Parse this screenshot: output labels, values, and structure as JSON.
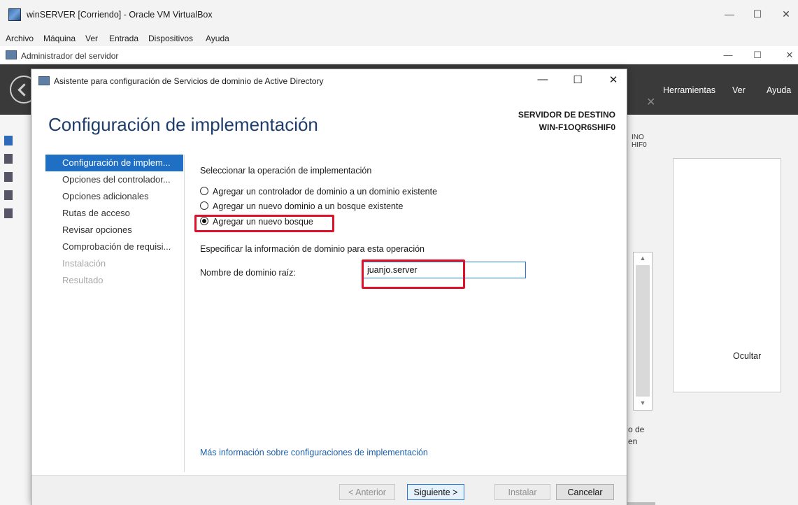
{
  "vbox": {
    "title": "winSERVER [Corriendo] - Oracle VM VirtualBox",
    "menu": [
      "Archivo",
      "Máquina",
      "Ver",
      "Entrada",
      "Dispositivos",
      "Ayuda"
    ],
    "controls": {
      "minimize": "—",
      "maximize": "☐",
      "close": "✕"
    }
  },
  "server_manager": {
    "title": "Administrador del servidor",
    "menu": [
      "Herramientas",
      "Ver",
      "Ayuda"
    ],
    "partial_dest_line1": "INO",
    "partial_dest_line2": "HIF0",
    "partial_text_line1": "o de",
    "partial_text_line2": "en",
    "hide_button": "Ocultar"
  },
  "wizard": {
    "title": "Asistente para configuración de Servicios de dominio de Active Directory",
    "heading": "Configuración de implementación",
    "destination_label": "SERVIDOR DE DESTINO",
    "destination_server": "WIN-F1OQR6SHIF0",
    "nav": [
      {
        "label": "Configuración de implem...",
        "state": "active"
      },
      {
        "label": "Opciones del controlador...",
        "state": "normal"
      },
      {
        "label": "Opciones adicionales",
        "state": "normal"
      },
      {
        "label": "Rutas de acceso",
        "state": "normal"
      },
      {
        "label": "Revisar opciones",
        "state": "normal"
      },
      {
        "label": "Comprobación de requisi...",
        "state": "normal"
      },
      {
        "label": "Instalación",
        "state": "disabled"
      },
      {
        "label": "Resultado",
        "state": "disabled"
      }
    ],
    "operation_label": "Seleccionar la operación de implementación",
    "options": [
      {
        "label": "Agregar un controlador de dominio a un dominio existente",
        "checked": false
      },
      {
        "label": "Agregar un nuevo dominio a un bosque existente",
        "checked": false
      },
      {
        "label": "Agregar un nuevo bosque",
        "checked": true
      }
    ],
    "domain_info_label": "Especificar la información de dominio para esta operación",
    "root_domain_label": "Nombre de dominio raíz:",
    "root_domain_value": "juanjo.server",
    "more_info_link": "Más información sobre configuraciones de implementación",
    "buttons": {
      "previous": "< Anterior",
      "next": "Siguiente >",
      "install": "Instalar",
      "cancel": "Cancelar"
    }
  },
  "colors": {
    "accent": "#1f6fc5",
    "heading": "#1f3d6b",
    "highlight": "#e0102a",
    "link": "#1d5fae",
    "header_dark": "#3a3a3a"
  }
}
